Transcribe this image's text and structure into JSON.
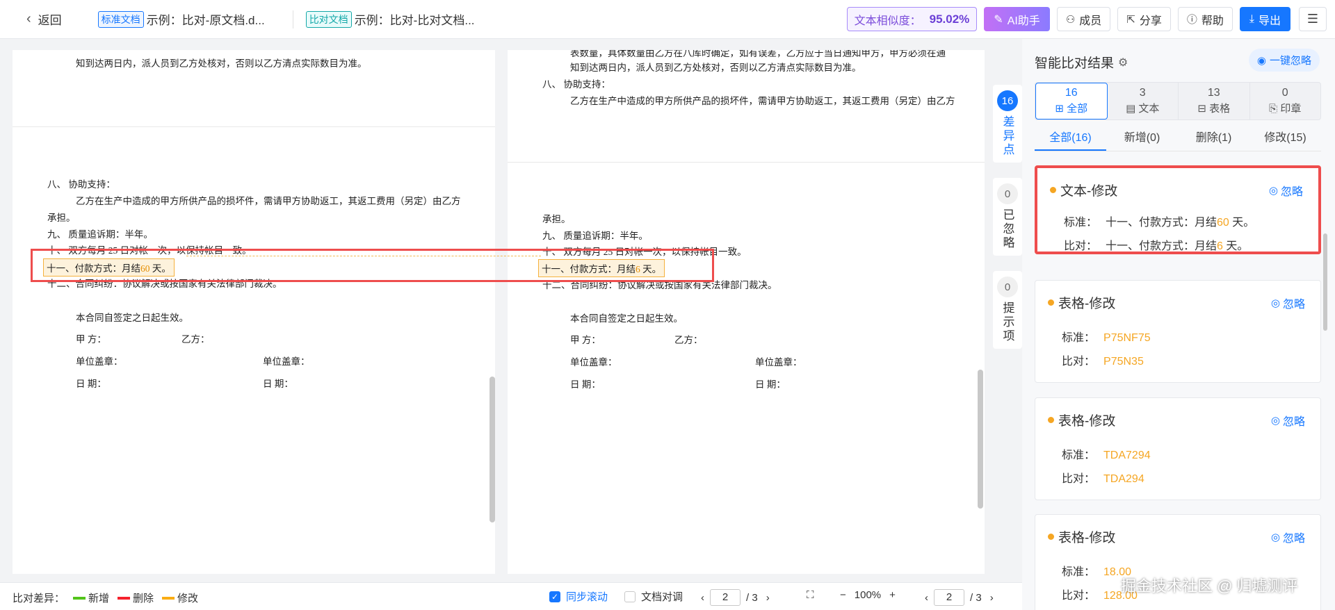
{
  "header": {
    "back": "返回",
    "std_tag": "标准文档",
    "std_name": "示例：比对-原文档.d...",
    "cmp_tag": "比对文档",
    "cmp_name": "示例：比对-比对文档...",
    "similarity_label": "文本相似度：",
    "similarity_value": "95.02%",
    "ai": "AI助手",
    "members": "成员",
    "share": "分享",
    "help": "帮助",
    "export": "导出"
  },
  "left_doc": {
    "lines": [
      "知到达两日内，派人员到乙方处核对，否则以乙方清点实际数目为准。",
      "八、    协助支持：",
      "乙方在生产中造成的甲方所供产品的损坏件，需请甲方协助返工，其返工费用（另定）由乙方",
      "承担。",
      "九、    质量追诉期：半年。",
      "十、    双方每月 25 日对帐一次，以保持帐目一致。",
      "十二、合同纠纷：协议解决或按国家有关法律部门裁决。",
      "本合同自签定之日起生效。",
      "甲      方：",
      "乙方：",
      "单位盖章：",
      "单位盖章：",
      "日      期：",
      "日      期："
    ],
    "hl_pre": "十一、付款方式：月结",
    "hl_num": "60",
    "hl_post": " 天。"
  },
  "right_doc": {
    "lines": [
      "表数量，具体数量由乙方在八库时确定，如有误差，乙方应于当日通知甲方，甲方必须在通",
      "知到达两日内，派人员到乙方处核对，否则以乙方清点实际数目为准。",
      "八、    协助支持：",
      "乙方在生产中造成的甲方所供产品的损坏件，需请甲方协助返工，其返工费用（另定）由乙方",
      "承担。",
      "九、    质量追诉期：半年。",
      "十、    双方每月 25 日对帐一次，以保持帐目一致。",
      "十二、合同纠纷：协议解决或按国家有关法律部门裁决。",
      "本合同自签定之日起生效。",
      "甲      方：",
      "乙方：",
      "单位盖章：",
      "单位盖章：",
      "日      期：",
      "日      期："
    ],
    "hl_pre": "十一、付款方式：月结",
    "hl_num": "6",
    "hl_post": " 天。"
  },
  "side_tabs": [
    {
      "count": "16",
      "label": "差异点"
    },
    {
      "count": "0",
      "label": "已忽略"
    },
    {
      "count": "0",
      "label": "提示项"
    }
  ],
  "results": {
    "title": "智能比对结果",
    "ignore_all": "一键忽略",
    "categories": [
      {
        "count": "16",
        "label": "全部"
      },
      {
        "count": "3",
        "label": "文本"
      },
      {
        "count": "13",
        "label": "表格"
      },
      {
        "count": "0",
        "label": "印章"
      }
    ],
    "filters": [
      "全部(16)",
      "新增(0)",
      "删除(1)",
      "修改(15)"
    ],
    "ignore": "忽略",
    "std_label": "标准：",
    "cmp_label": "比对：",
    "cards": [
      {
        "title": "文本-修改",
        "std_pre": "十一、付款方式：月结",
        "std_hl": "60",
        "std_post": " 天。",
        "cmp_pre": "十一、付款方式：月结",
        "cmp_hl": "6",
        "cmp_post": " 天。"
      },
      {
        "title": "表格-修改",
        "std": "P75NF75",
        "cmp": "P75N35"
      },
      {
        "title": "表格-修改",
        "std": "TDA7294",
        "cmp": "TDA294"
      },
      {
        "title": "表格-修改",
        "std": "18.00",
        "cmp": "128.00"
      }
    ]
  },
  "bottom": {
    "legend_label": "比对差异：",
    "legend": [
      {
        "label": "新增",
        "color": "#52c41a"
      },
      {
        "label": "删除",
        "color": "#f5222d"
      },
      {
        "label": "修改",
        "color": "#faad14"
      }
    ],
    "sync_scroll": "同步滚动",
    "doc_swap": "文档对调",
    "page_left": "2",
    "total_left": "/ 3",
    "zoom": "100%",
    "page_right": "2",
    "total_right": "/ 3"
  },
  "watermark": "掘金技术社区 @ 归墟测评"
}
